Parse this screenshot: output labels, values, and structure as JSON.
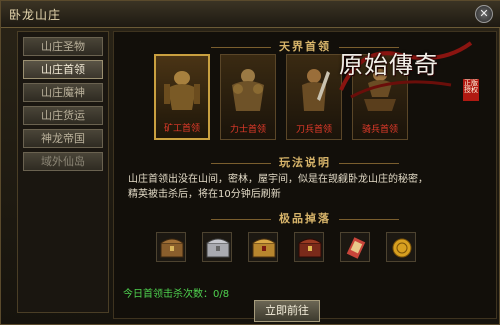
{
  "window": {
    "title": "卧龙山庄",
    "close_icon": "close-icon"
  },
  "sidebar": {
    "items": [
      {
        "label": "山庄圣物",
        "state": "normal"
      },
      {
        "label": "山庄首领",
        "state": "active"
      },
      {
        "label": "山庄魔神",
        "state": "normal"
      },
      {
        "label": "山庄货运",
        "state": "normal"
      },
      {
        "label": "神龙帝国",
        "state": "normal"
      },
      {
        "label": "域外仙岛",
        "state": "dim"
      }
    ]
  },
  "main": {
    "section_bosses": "天界首领",
    "bosses": [
      {
        "name": "矿工首领",
        "icon": "miner-boss-icon"
      },
      {
        "name": "力士首领",
        "icon": "strongman-boss-icon"
      },
      {
        "name": "刀兵首领",
        "icon": "blade-soldier-boss-icon"
      },
      {
        "name": "骑兵首领",
        "icon": "cavalry-boss-icon"
      }
    ],
    "section_rules": "玩法说明",
    "rules_text": "山庄首领出没在山间，密林，屋宇间，似是在觊觎卧龙山庄的秘密，精英被击杀后，将在10分钟后刷新",
    "section_drops": "极品掉落",
    "drops": [
      {
        "icon": "wooden-chest-icon"
      },
      {
        "icon": "silver-chest-icon"
      },
      {
        "icon": "gold-chest-icon"
      },
      {
        "icon": "red-chest-icon"
      },
      {
        "icon": "scroll-icon"
      },
      {
        "icon": "gold-coin-icon"
      }
    ],
    "kill_count": "今日首领击杀次数：0/8",
    "go_button": "立即前往"
  },
  "logo": {
    "text": "原始傳奇",
    "seal": "正版授权"
  },
  "colors": {
    "accent": "#d7b46a",
    "boss_name": "#e23a2a",
    "count": "#4fd34f"
  }
}
